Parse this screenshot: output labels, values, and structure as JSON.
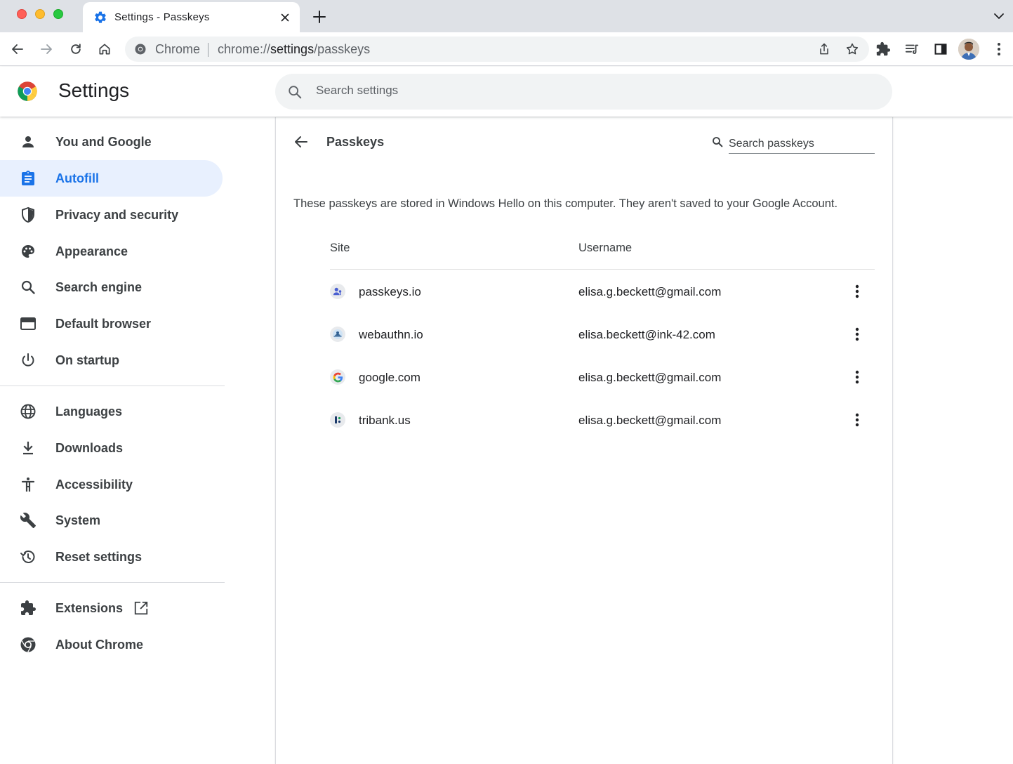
{
  "window": {
    "tab_title": "Settings - Passkeys"
  },
  "toolbar": {
    "omnibox_scheme_label": "Chrome",
    "url_prefix": "chrome://",
    "url_host": "settings",
    "url_path": "/passkeys"
  },
  "header": {
    "title": "Settings",
    "search_placeholder": "Search settings"
  },
  "sidebar": {
    "items": [
      {
        "label": "You and Google",
        "icon": "person-icon"
      },
      {
        "label": "Autofill",
        "icon": "clipboard-icon",
        "active": true
      },
      {
        "label": "Privacy and security",
        "icon": "shield-icon"
      },
      {
        "label": "Appearance",
        "icon": "palette-icon"
      },
      {
        "label": "Search engine",
        "icon": "search-icon"
      },
      {
        "label": "Default browser",
        "icon": "browser-window-icon"
      },
      {
        "label": "On startup",
        "icon": "power-icon"
      },
      {
        "label": "Languages",
        "icon": "globe-icon"
      },
      {
        "label": "Downloads",
        "icon": "download-icon"
      },
      {
        "label": "Accessibility",
        "icon": "accessibility-icon"
      },
      {
        "label": "System",
        "icon": "wrench-icon"
      },
      {
        "label": "Reset settings",
        "icon": "history-icon"
      },
      {
        "label": "Extensions",
        "icon": "puzzle-icon"
      },
      {
        "label": "About Chrome",
        "icon": "chrome-icon"
      }
    ]
  },
  "passkeys": {
    "title": "Passkeys",
    "search_placeholder": "Search passkeys",
    "description": "These passkeys are stored in Windows Hello on this computer. They aren't saved to your Google Account.",
    "columns": {
      "site": "Site",
      "username": "Username"
    },
    "rows": [
      {
        "site": "passkeys.io",
        "username": "elisa.g.beckett@gmail.com",
        "favicon": "passkeys-favicon-icon"
      },
      {
        "site": "webauthn.io",
        "username": "elisa.beckett@ink-42.com",
        "favicon": "webauthn-favicon-icon"
      },
      {
        "site": "google.com",
        "username": "elisa.g.beckett@gmail.com",
        "favicon": "google-favicon-icon"
      },
      {
        "site": "tribank.us",
        "username": "elisa.g.beckett@gmail.com",
        "favicon": "tribank-favicon-icon"
      }
    ]
  },
  "colors": {
    "accent": "#1a73e8",
    "active_nav_bg": "#e8f0fe",
    "tabstrip_bg": "#dee1e6",
    "omnibox_bg": "#f1f3f4",
    "text_primary": "#202124",
    "text_secondary": "#3c4043"
  }
}
